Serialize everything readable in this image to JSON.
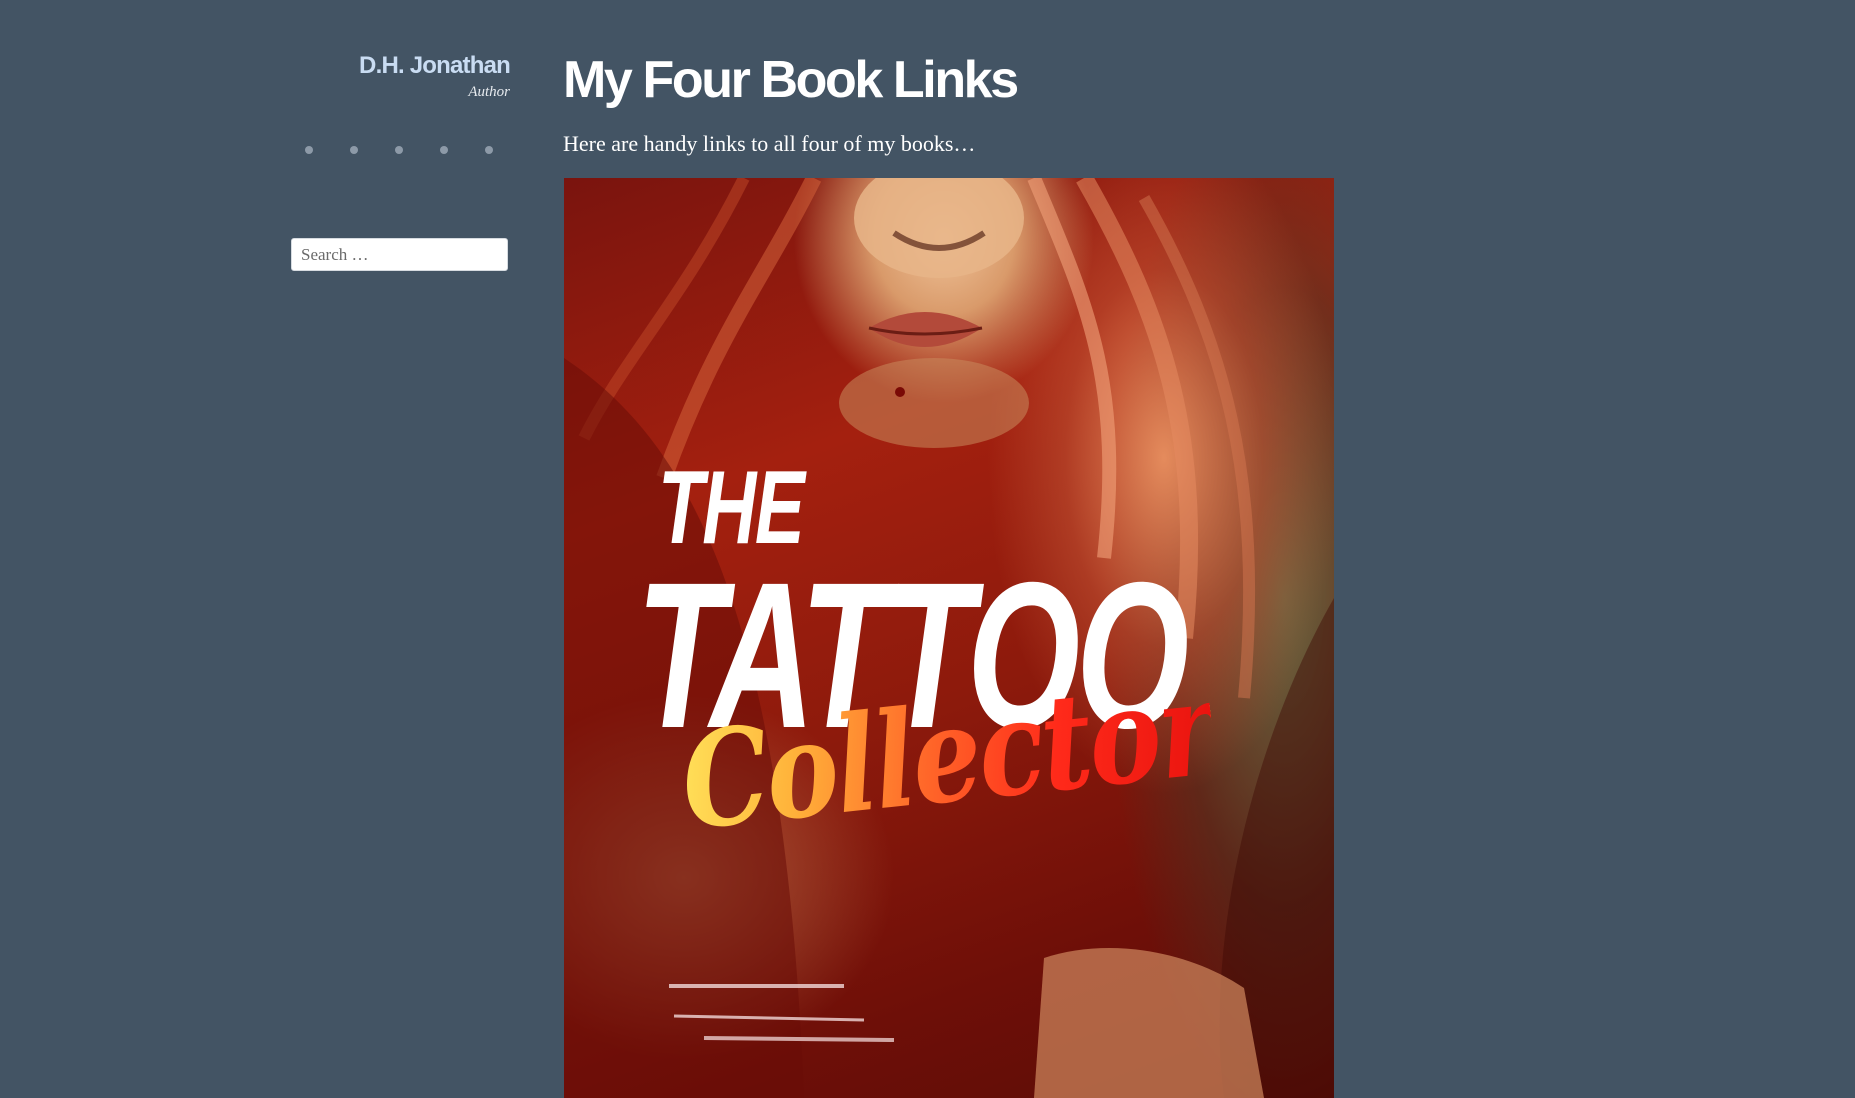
{
  "site": {
    "title": "D.H. Jonathan",
    "tagline": "Author"
  },
  "social": {
    "icons": [
      "social-icon-1",
      "social-icon-2",
      "social-icon-3",
      "social-icon-4",
      "social-icon-5"
    ]
  },
  "search": {
    "placeholder": "Search …"
  },
  "post": {
    "title": "My Four Book Links",
    "intro": "Here are handy links to all four of my books…"
  },
  "book_cover": {
    "line1": "THE",
    "line2": "TATTOO",
    "line3": "Collector"
  },
  "colors": {
    "background": "#435464",
    "site_title": "#c9dcf2",
    "text": "#ffffff"
  }
}
